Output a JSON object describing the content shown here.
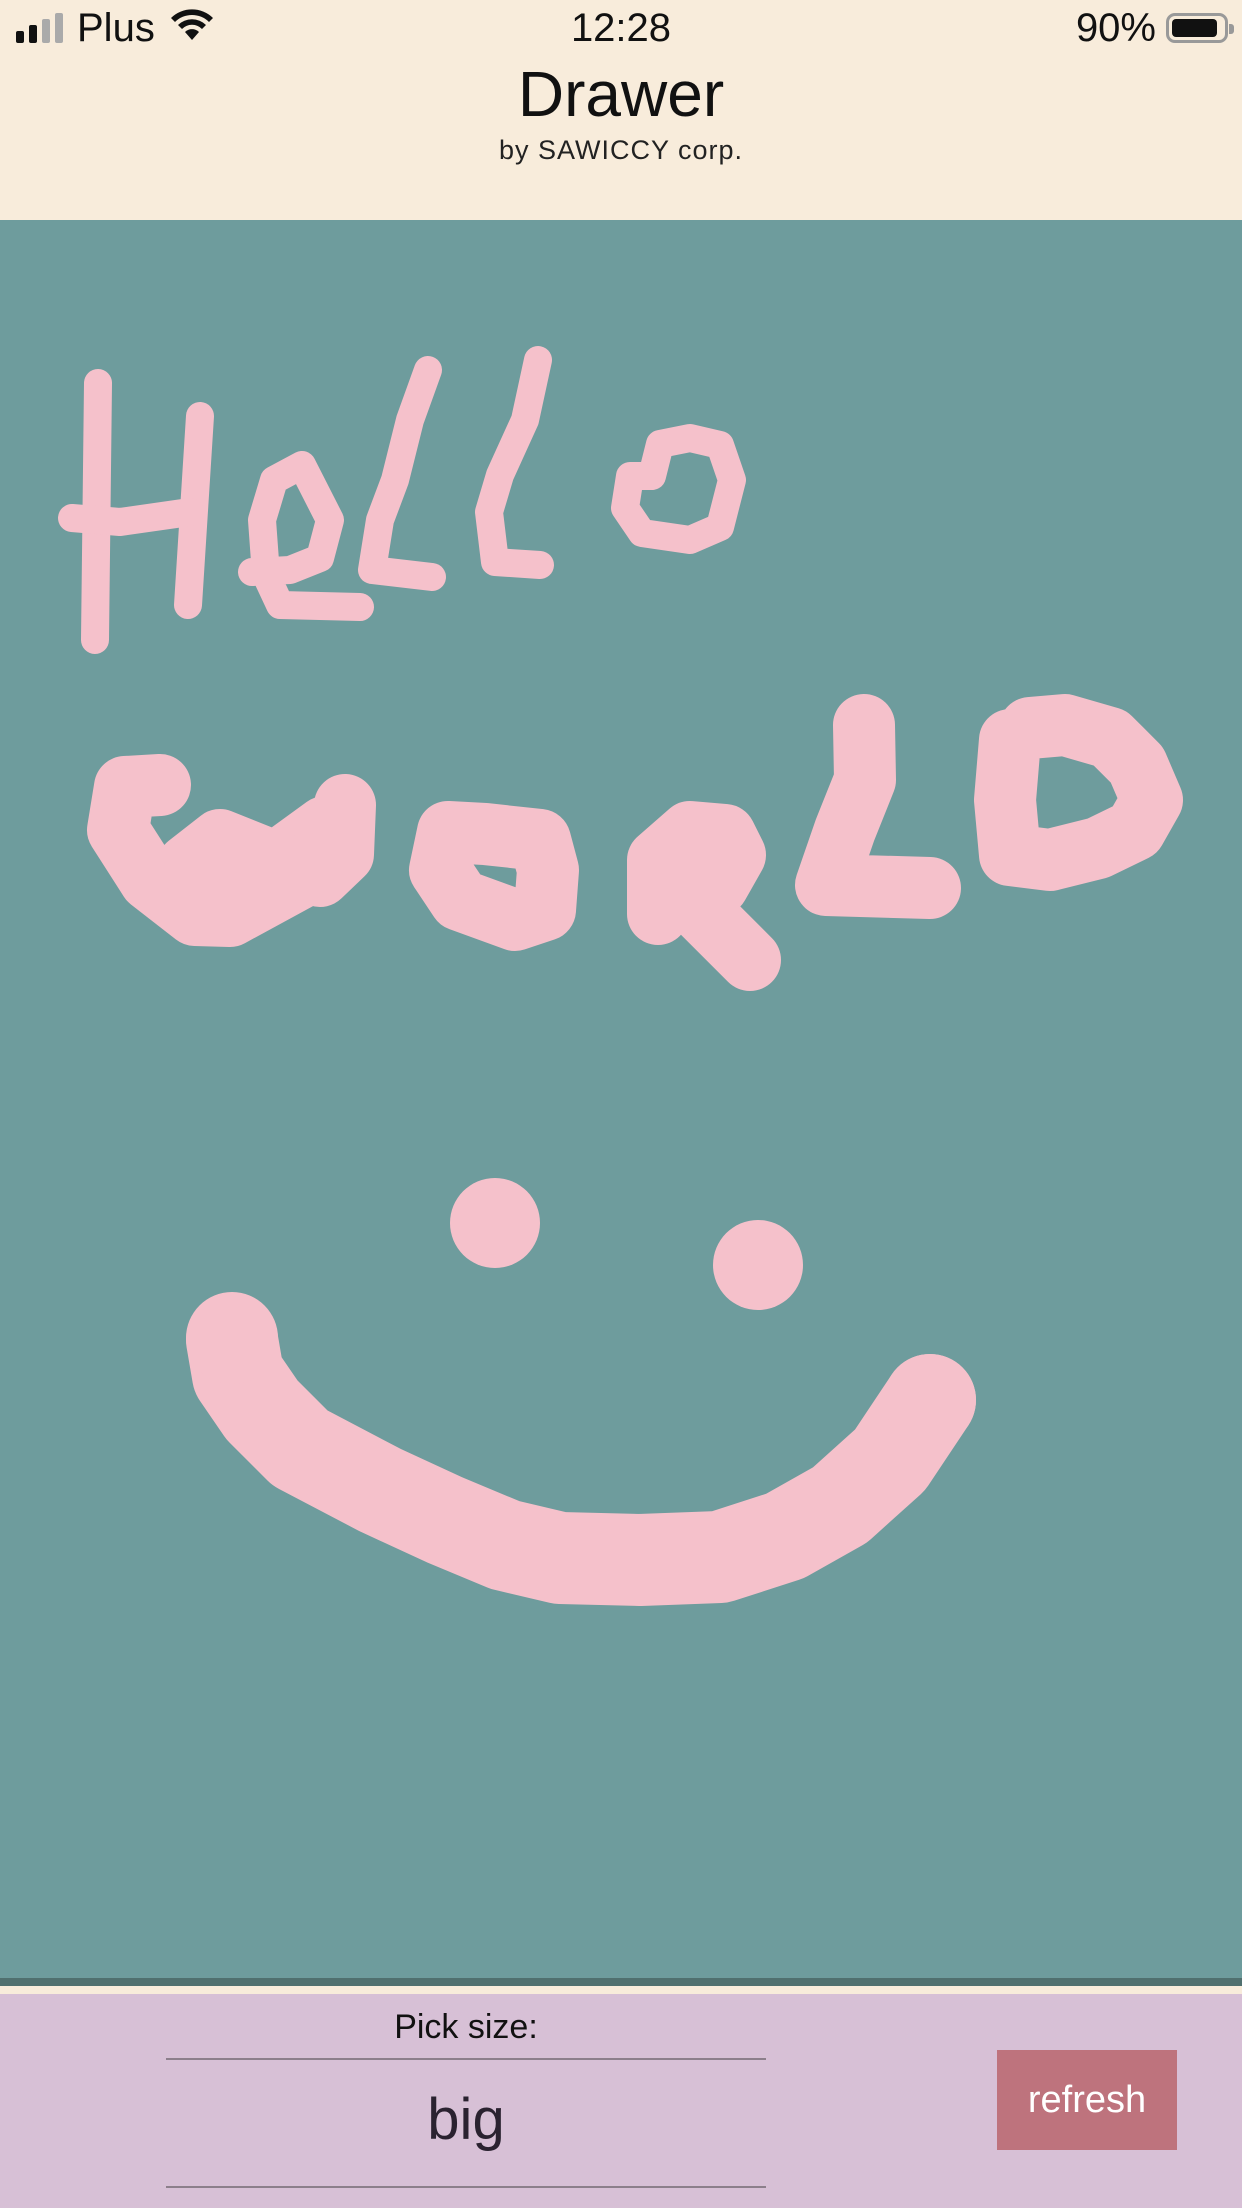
{
  "status_bar": {
    "carrier": "Plus",
    "time": "12:28",
    "battery": "90%",
    "battery_level": 0.9,
    "signal_strength": 2,
    "signal_max": 4,
    "icons": [
      "signal-icon",
      "wifi-icon",
      "battery-icon"
    ]
  },
  "header": {
    "title": "Drawer",
    "subtitle": "by SAWICCY corp."
  },
  "canvas": {
    "background_color": "#6e9c9d",
    "stroke_color": "#f5c1cb"
  },
  "controls": {
    "picker_label": "Pick size:",
    "picker_value": "big",
    "refresh_label": "refresh",
    "refresh_color": "#be737d",
    "panel_color": "#d7c0d6"
  }
}
